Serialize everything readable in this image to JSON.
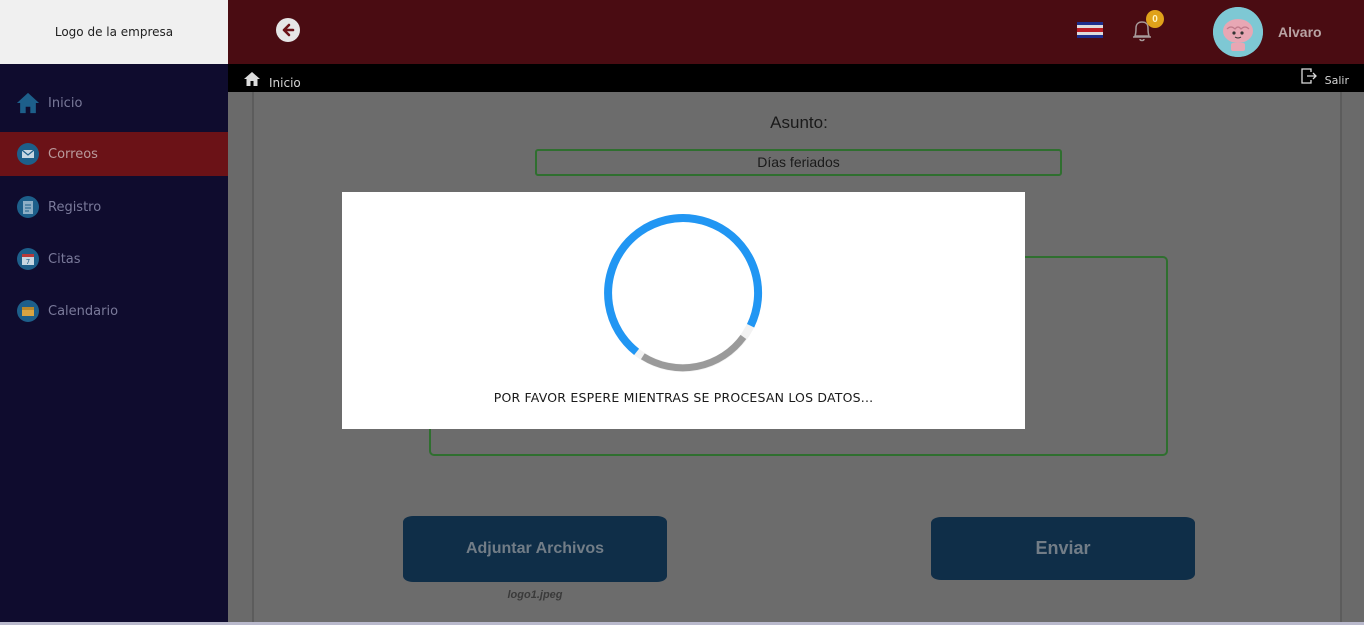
{
  "brand": {
    "logo_text": "Logo de la empresa"
  },
  "header": {
    "notification_count": "0",
    "user_name": "Alvaro"
  },
  "breadcrumb": {
    "home_label": "Inicio",
    "logout_label": "Salir"
  },
  "sidebar": {
    "items": [
      {
        "label": "Inicio",
        "icon": "home-icon",
        "active": false
      },
      {
        "label": "Correos",
        "icon": "mail-icon",
        "active": true
      },
      {
        "label": "Registro",
        "icon": "clipboard-icon",
        "active": false
      },
      {
        "label": "Citas",
        "icon": "calendar-day-icon",
        "active": false
      },
      {
        "label": "Calendario",
        "icon": "calendar-icon",
        "active": false
      }
    ]
  },
  "form": {
    "subject_label": "Asunto:",
    "subject_value": "Días feriados",
    "attach_label": "Adjuntar Archivos",
    "send_label": "Enviar",
    "attached_file": "logo1.jpeg"
  },
  "modal": {
    "message": "POR FAVOR ESPERE MIENTRAS SE PROCESAN LOS DATOS..."
  },
  "colors": {
    "header_bg": "#4a0c12",
    "sidebar_bg": "#0f0c2e",
    "active_item": "#6b1217",
    "spinner": "#2196f3",
    "button_bg": "#0f2e48"
  }
}
